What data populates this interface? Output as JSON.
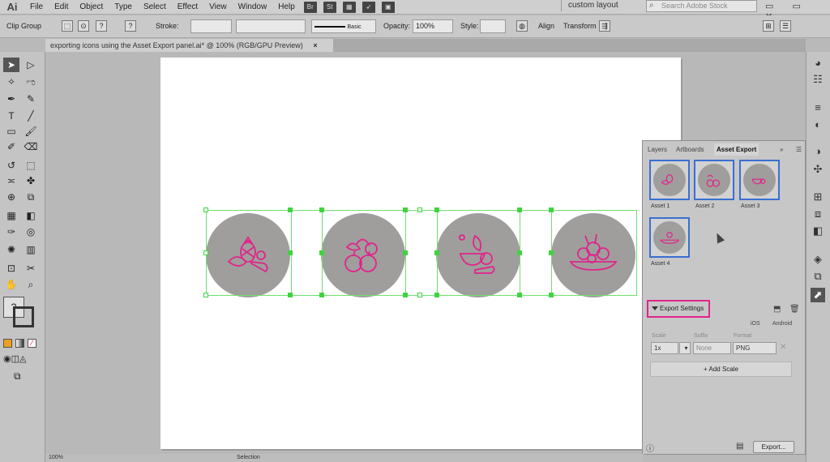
{
  "app": {
    "logo": "Ai"
  },
  "menu": {
    "items": [
      "File",
      "Edit",
      "Object",
      "Type",
      "Select",
      "Effect",
      "View",
      "Window",
      "Help"
    ],
    "bridge": "Br",
    "stock": "St",
    "workspace": "custom layout",
    "search_placeholder": "Search Adobe Stock"
  },
  "control_bar": {
    "selection_label": "Clip Group",
    "stroke_label": "Stroke:",
    "brush_label": "Basic",
    "opacity_label": "Opacity:",
    "opacity_value": "100%",
    "style_label": "Style:",
    "align_label": "Align",
    "transform_label": "Transform"
  },
  "document": {
    "tab_title": "exporting icons using the Asset Export panel.ai* @ 100% (RGB/GPU Preview)",
    "close": "×"
  },
  "asset_panel": {
    "tabs": [
      "Layers",
      "Artboards",
      "Asset Export"
    ],
    "assets": [
      "Asset 1",
      "Asset 2",
      "Asset 3",
      "Asset 4"
    ],
    "export_settings_label": "Export Settings",
    "ios_label": "iOS",
    "android_label": "Android",
    "scale_header": "Scale",
    "suffix_header": "Suffix",
    "format_header": "Format",
    "scale_value": "1x",
    "suffix_placeholder": "None",
    "format_value": "PNG",
    "add_scale_label": "+ Add Scale",
    "export_label": "Export..."
  },
  "status": {
    "zoom": "100%",
    "selection": "Selection"
  },
  "colors": {
    "icon_stroke": "#e0248c",
    "circle_fill": "#a09e9c",
    "selection_green": "#3fd43f",
    "asset_border": "#3a6fd0"
  }
}
